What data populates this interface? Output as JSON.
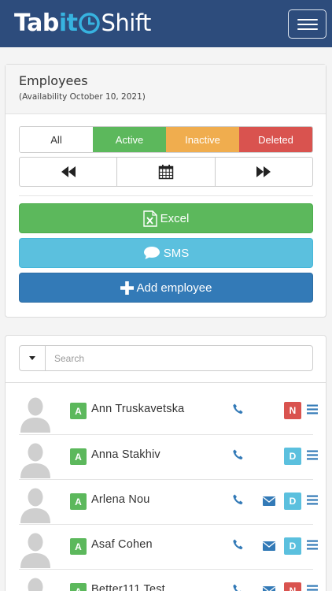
{
  "app": {
    "brand_prefix": "Tab",
    "brand_accent": "it",
    "brand_suffix": "Shift",
    "menu_icon": "hamburger-icon"
  },
  "panel": {
    "title": "Employees",
    "subtitle": "(Availability October 10, 2021)"
  },
  "filters": {
    "all": "All",
    "active": "Active",
    "inactive": "Inactive",
    "deleted": "Deleted",
    "selected": "All"
  },
  "date_nav": {
    "prev_icon": "backward-icon",
    "calendar_icon": "calendar-icon",
    "next_icon": "forward-icon"
  },
  "actions": {
    "excel": "Excel",
    "sms": "SMS",
    "add": "Add employee"
  },
  "search": {
    "placeholder": "Search"
  },
  "employees": [
    {
      "name": "Ann Truskavetska",
      "status": "A",
      "phone": true,
      "email": false,
      "shift": "N"
    },
    {
      "name": "Anna Stakhiv",
      "status": "A",
      "phone": true,
      "email": false,
      "shift": "D"
    },
    {
      "name": "Arlena Nou",
      "status": "A",
      "phone": true,
      "email": true,
      "shift": "D"
    },
    {
      "name": "Asaf Cohen",
      "status": "A",
      "phone": true,
      "email": true,
      "shift": "D"
    },
    {
      "name": "Better111 Test",
      "status": "A",
      "phone": true,
      "email": true,
      "shift": "N"
    }
  ],
  "colors": {
    "navbar": "#2d4c7c",
    "brand_accent": "#37b3e0",
    "success": "#5cb85c",
    "warning": "#f0ad4e",
    "danger": "#d9534f",
    "info": "#5bc0de",
    "primary": "#337ab7",
    "link_icon": "#337ab7"
  }
}
